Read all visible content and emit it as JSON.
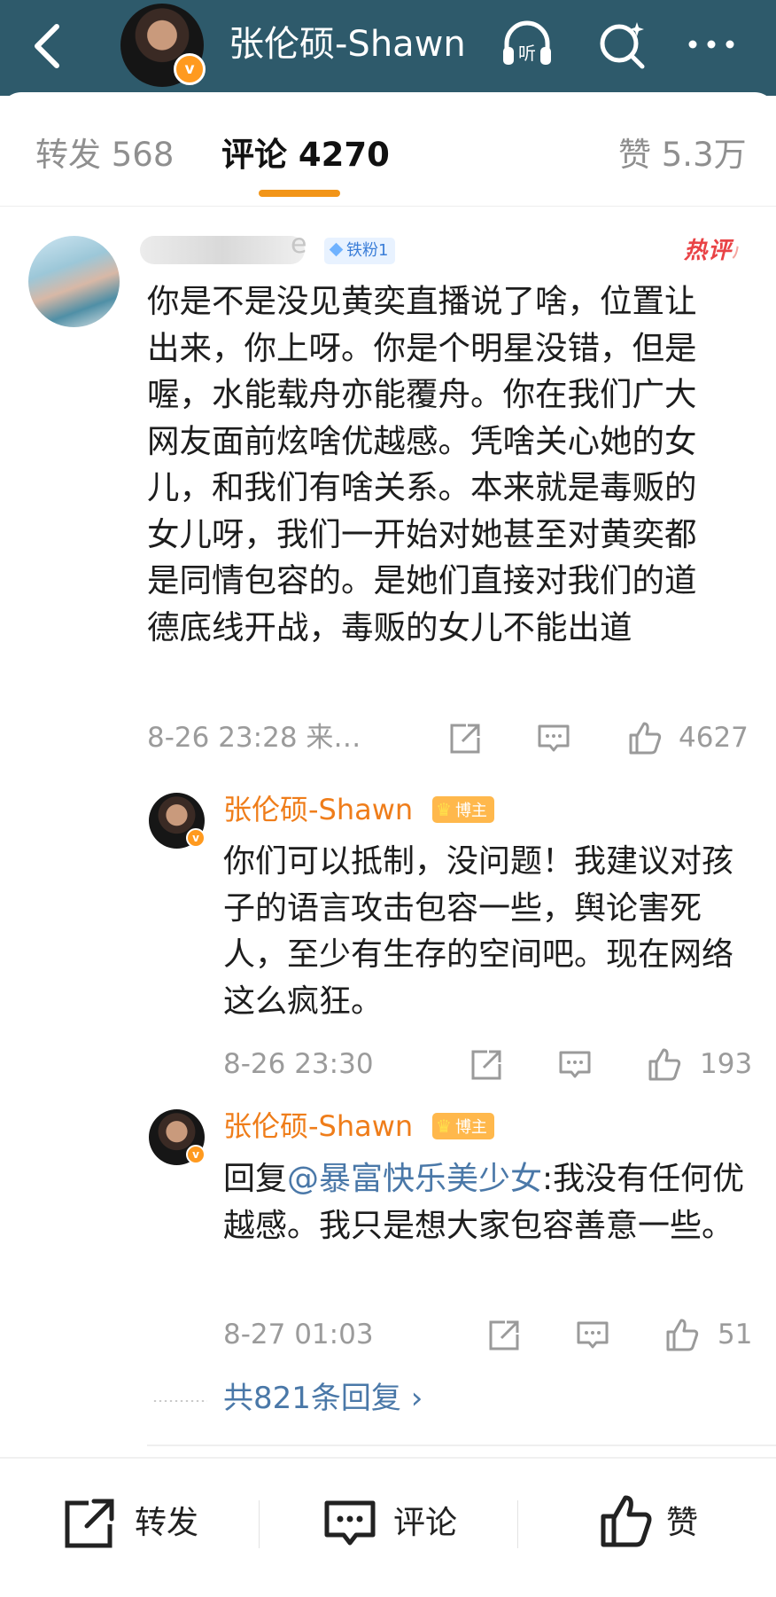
{
  "header": {
    "title": "张伦硕-Shawn",
    "verified_mark": "v",
    "icons": [
      "back-chevron-icon",
      "listen-headphones-icon",
      "ai-search-icon",
      "more-dots-icon"
    ],
    "listen_label": "听",
    "background_color": "#2e5a6b"
  },
  "tabs": [
    {
      "label": "转发 568"
    },
    {
      "label": "评论 4270",
      "active": true
    },
    {
      "label": "赞 5.3万"
    }
  ],
  "comment": {
    "name_tail": "e",
    "fan_badge": "铁粉1",
    "hot_label": "热评",
    "text": "你是不是没见黄奕直播说了啥，位置让出来，你上呀。你是个明星没错，但是喔，水能载舟亦能覆舟。你在我们广大网友面前炫啥优越感。凭啥关心她的女儿，和我们有啥关系。本来就是毒贩的女儿呀，我们一开始对她甚至对黄奕都是同情包容的。是她们直接对我们的道德底线开战，毒贩的女儿不能出道",
    "time": "8-26 23:28 来…",
    "likes": "4627"
  },
  "replies": [
    {
      "name": "张伦硕-Shawn",
      "badge": "博主",
      "prefix": "",
      "mention": "",
      "text": "你们可以抵制，没问题！我建议对孩子的语言攻击包容一些，舆论害死人，至少有生存的空间吧。现在网络这么疯狂。",
      "time": "8-26 23:30",
      "likes": "193"
    },
    {
      "name": "张伦硕-Shawn",
      "badge": "博主",
      "prefix": "回复",
      "mention": "@暴富快乐美少女",
      "text": ":我没有任何优越感。我只是想大家包容善意一些。",
      "time": "8-27 01:03",
      "likes": "51"
    }
  ],
  "more_replies": "共821条回复",
  "more_replies_arrow": "›",
  "bottom_bar": {
    "repost": "转发",
    "comment": "评论",
    "like": "赞"
  },
  "colors": {
    "accent_orange": "#f29518",
    "link_blue": "#4a78a8",
    "hot_red": "#e94346"
  }
}
